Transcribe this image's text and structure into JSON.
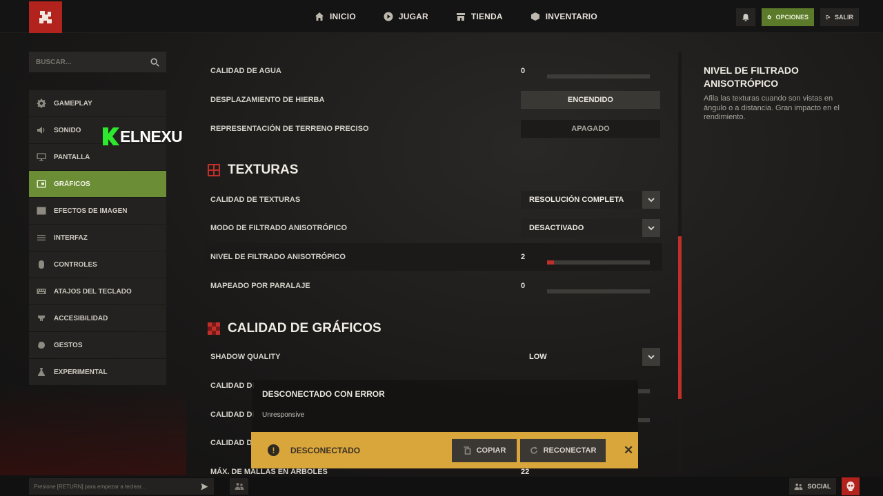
{
  "topbar": {
    "nav": [
      {
        "label": "INICIO",
        "icon": "home-icon"
      },
      {
        "label": "JUGAR",
        "icon": "play-icon"
      },
      {
        "label": "TIENDA",
        "icon": "store-icon"
      },
      {
        "label": "INVENTARIO",
        "icon": "inventory-icon"
      }
    ],
    "opciones_label": "OPCIONES",
    "salir_label": "SALIR"
  },
  "search": {
    "placeholder": "BUSCAR..."
  },
  "watermark": {
    "text": "ELNEXU"
  },
  "sidebar": {
    "items": [
      {
        "label": "GAMEPLAY",
        "icon": "gear-icon",
        "active": false
      },
      {
        "label": "SONIDO",
        "icon": "speaker-icon",
        "active": false
      },
      {
        "label": "PANTALLA",
        "icon": "monitor-icon",
        "active": false
      },
      {
        "label": "GRÁFICOS",
        "icon": "graphics-icon",
        "active": true
      },
      {
        "label": "EFECTOS DE IMAGEN",
        "icon": "image-icon",
        "active": false
      },
      {
        "label": "INTERFAZ",
        "icon": "menu-lines-icon",
        "active": false
      },
      {
        "label": "CONTROLES",
        "icon": "mouse-icon",
        "active": false
      },
      {
        "label": "ATAJOS DEL TECLADO",
        "icon": "keyboard-icon",
        "active": false
      },
      {
        "label": "ACCESIBILIDAD",
        "icon": "accessibility-icon",
        "active": false
      },
      {
        "label": "GESTOS",
        "icon": "gesture-icon",
        "active": false
      },
      {
        "label": "EXPERIMENTAL",
        "icon": "flask-icon",
        "active": false
      }
    ]
  },
  "settings": {
    "calidad_agua": {
      "label": "CALIDAD DE AGUA",
      "value": "0",
      "level": 0
    },
    "desplazamiento_hierba": {
      "label": "DESPLAZAMIENTO DE HIERBA",
      "value": "ENCENDIDO"
    },
    "terreno_preciso": {
      "label": "REPRESENTACIÓN DE TERRENO PRECISO",
      "value": "APAGADO"
    },
    "section_texturas": "TEXTURAS",
    "calidad_texturas": {
      "label": "CALIDAD DE TEXTURAS",
      "value": "RESOLUCIÓN COMPLETA"
    },
    "modo_filtrado": {
      "label": "MODO DE FILTRADO ANISOTRÓPICO",
      "value": "DESACTIVADO"
    },
    "nivel_filtrado": {
      "label": "NIVEL DE FILTRADO ANISOTRÓPICO",
      "value": "2",
      "level": 0.07
    },
    "mapeado_paralaje": {
      "label": "MAPEADO POR PARALAJE",
      "value": "0",
      "level": 0
    },
    "section_calidad": "CALIDAD DE GRÁFICOS",
    "shadow_quality": {
      "label": "SHADOW QUALITY",
      "value": "LOW"
    },
    "calidad_row1": {
      "label": "CALIDAD DI"
    },
    "calidad_row2": {
      "label": "CALIDAD DI"
    },
    "calidad_row3": {
      "label": "CALIDAD DI"
    },
    "mallas_arboles": {
      "label": "MÁX. DE MALLAS EN ÁRBOLES",
      "value": "22",
      "level": 0.13
    }
  },
  "description": {
    "title": "NIVEL DE FILTRADO ANISOTRÓPICO",
    "text": "Afila las texturas cuando son vistas en ángulo o a distancia. Gran impacto en el rendimiento."
  },
  "error": {
    "title": "DESCONECTADO CON ERROR",
    "subtitle": "Unresponsive"
  },
  "alert": {
    "text": "DESCONECTADO",
    "copy_label": "COPIAR",
    "reconnect_label": "RECONECTAR",
    "color": "#d9a63c"
  },
  "bottom": {
    "chat_placeholder": "Presione [RETURN] para empezar a teclear...",
    "social_label": "SOCIAL"
  },
  "colors": {
    "accent_green": "#6b8d35",
    "accent_red": "#c0302a"
  }
}
